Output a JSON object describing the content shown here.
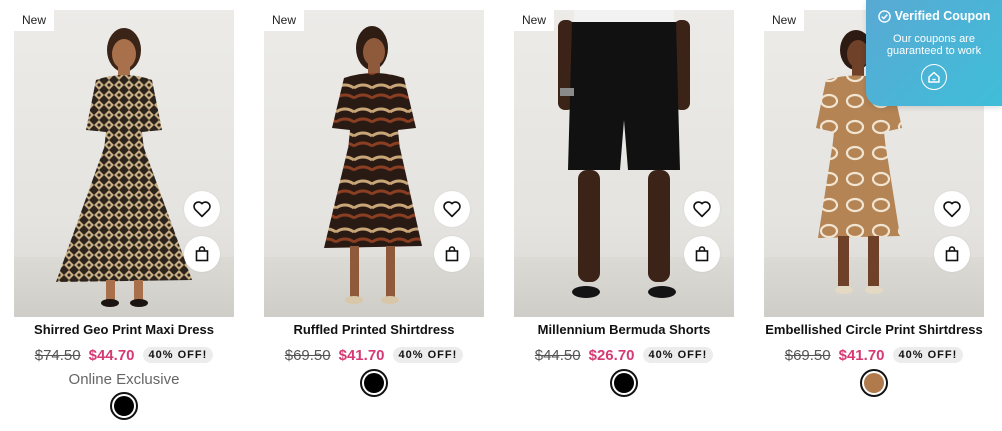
{
  "products": [
    {
      "badge": "New",
      "name": "Shirred Geo Print Maxi Dress",
      "original_price": "$74.50",
      "sale_price": "$44.70",
      "discount": "40% OFF!",
      "note": "Online Exclusive",
      "swatches": [
        "#000000"
      ]
    },
    {
      "badge": "New",
      "name": "Ruffled Printed Shirtdress",
      "original_price": "$69.50",
      "sale_price": "$41.70",
      "discount": "40% OFF!",
      "swatches": [
        "#000000"
      ]
    },
    {
      "badge": "New",
      "name": "Millennium Bermuda Shorts",
      "original_price": "$44.50",
      "sale_price": "$26.70",
      "discount": "40% OFF!",
      "swatches": [
        "#000000"
      ]
    },
    {
      "badge": "New",
      "name": "Embellished Circle Print Shirtdress",
      "original_price": "$69.50",
      "sale_price": "$41.70",
      "discount": "40% OFF!",
      "swatches": [
        "#b07a4c"
      ]
    }
  ],
  "coupon_popup": {
    "title": "Verified Coupon",
    "message_line1": "Our coupons are",
    "message_line2": "guaranteed to work"
  },
  "icons": {
    "wishlist": "heart-icon",
    "add_to_bag": "shopping-bag-icon",
    "verified": "check-circle-icon",
    "brand": "home-logo-icon"
  },
  "colors": {
    "sale_price": "#d63a74",
    "coupon_bg": "#4ab3d6"
  }
}
